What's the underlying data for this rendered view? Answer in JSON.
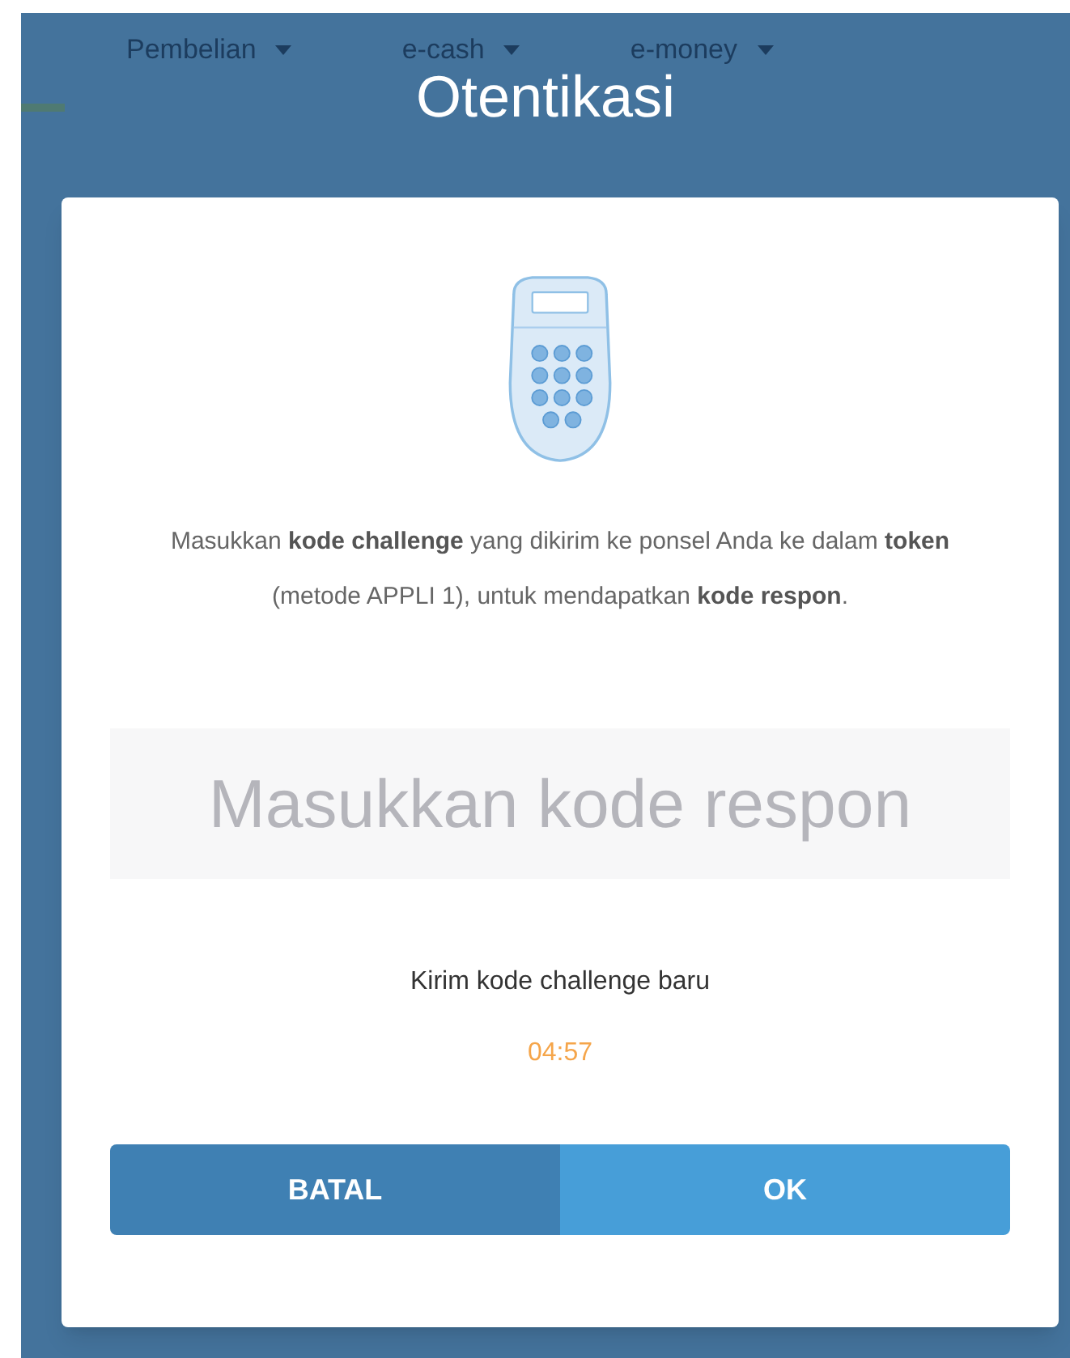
{
  "nav": [
    {
      "label": "Pembelian"
    },
    {
      "label": "e-cash"
    },
    {
      "label": "e-money"
    }
  ],
  "dialog": {
    "title": "Otentikasi",
    "message": "Masukkan **kode challenge** yang dikirim ke ponsel Anda ke dalam **token** (metode APPLI 1), untuk mendapatkan **kode respon**.",
    "input": {
      "placeholder": "Masukkan kode respon"
    },
    "resend_link": "Kirim kode challenge baru",
    "timer": "04:57",
    "buttons": [
      {
        "label": "BATAL",
        "kind": "secondary"
      },
      {
        "label": "OK",
        "kind": "primary"
      }
    ]
  }
}
